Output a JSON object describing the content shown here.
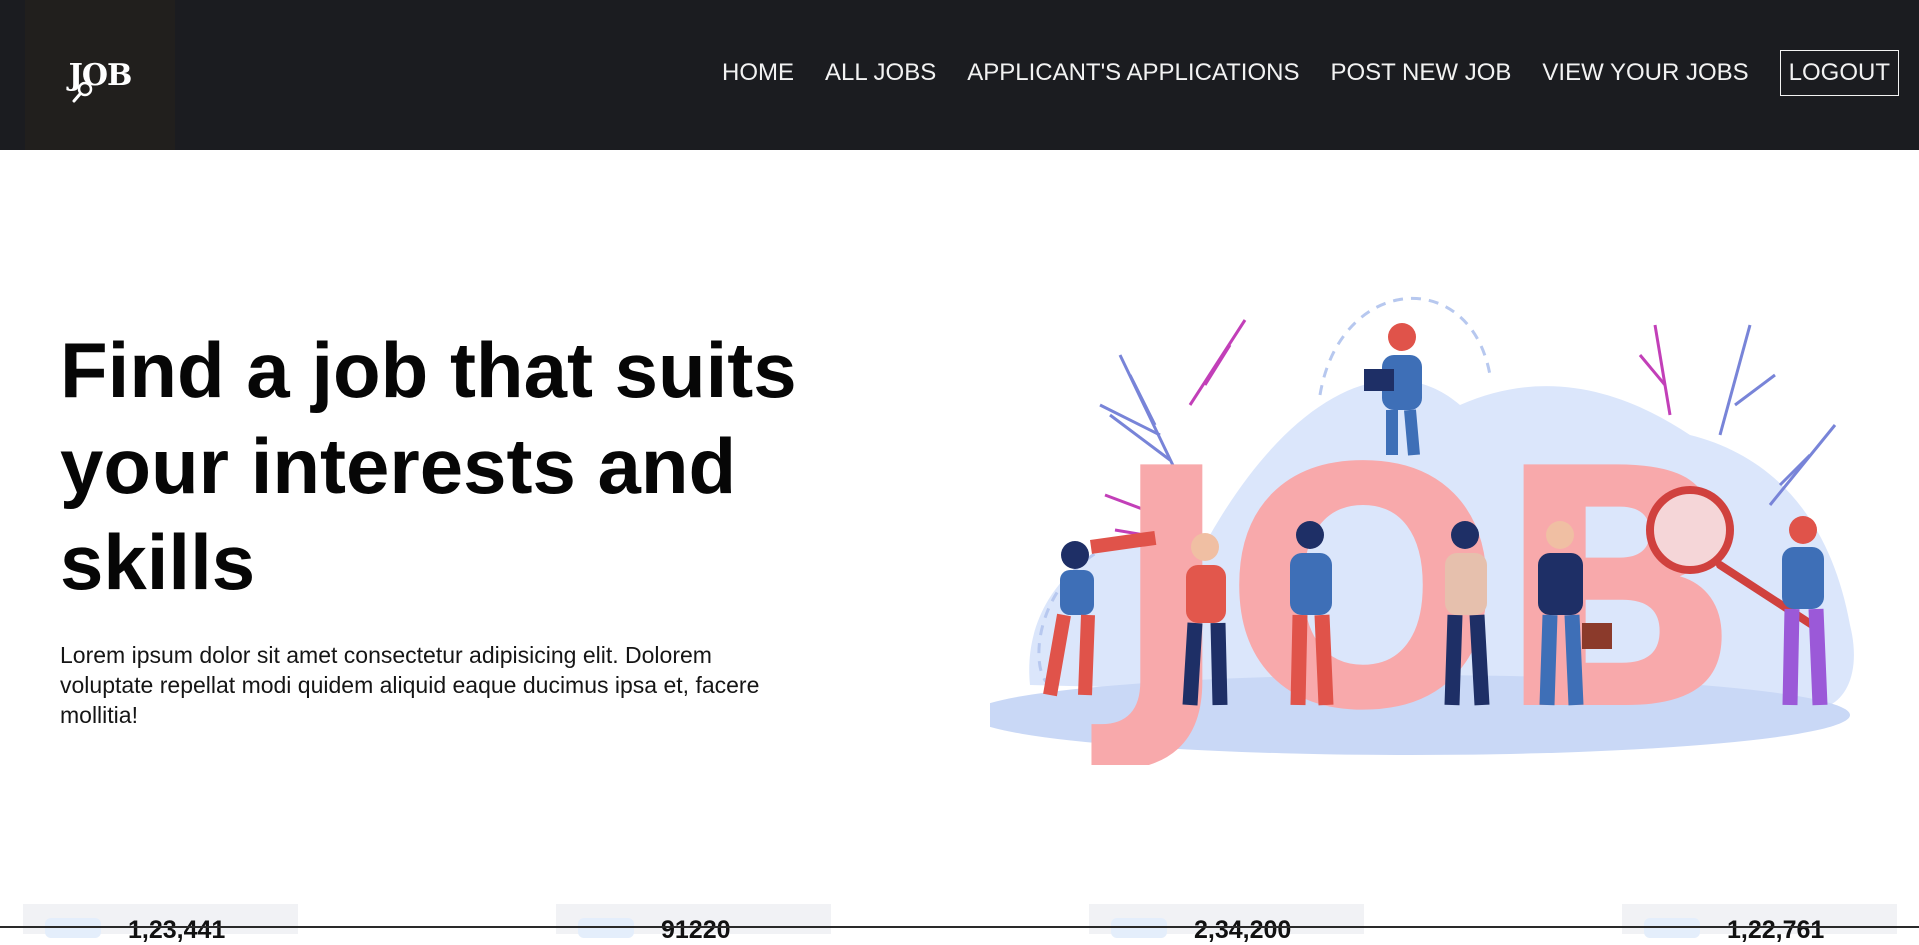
{
  "navbar": {
    "logo_text": "JOB",
    "items": [
      {
        "label": "HOME"
      },
      {
        "label": "ALL JOBS"
      },
      {
        "label": "APPLICANT'S APPLICATIONS"
      },
      {
        "label": "POST NEW JOB"
      },
      {
        "label": "VIEW YOUR JOBS"
      }
    ],
    "logout_label": "LOGOUT"
  },
  "hero": {
    "title": "Find a job that suits your interests and skills",
    "description": "Lorem ipsum dolor sit amet consectetur adipisicing elit. Dolorem voluptate repellat modi quidem aliquid eaque ducimus ipsa et, facere mollitia!",
    "illustration_text": "JOB"
  },
  "stats": [
    {
      "value": "1,23,441",
      "icon": "stat-icon"
    },
    {
      "value": "91220",
      "icon": "stat-icon"
    },
    {
      "value": "2,34,200",
      "icon": "stat-icon"
    },
    {
      "value": "1,22,761",
      "icon": "stat-icon"
    }
  ],
  "colors": {
    "navbar_bg": "#1b1c20",
    "logo_bg": "#211f1d",
    "nav_text": "#f2f2f2",
    "illustration_pink": "#f8a9ab",
    "illustration_blue": "#dbe6fb"
  }
}
